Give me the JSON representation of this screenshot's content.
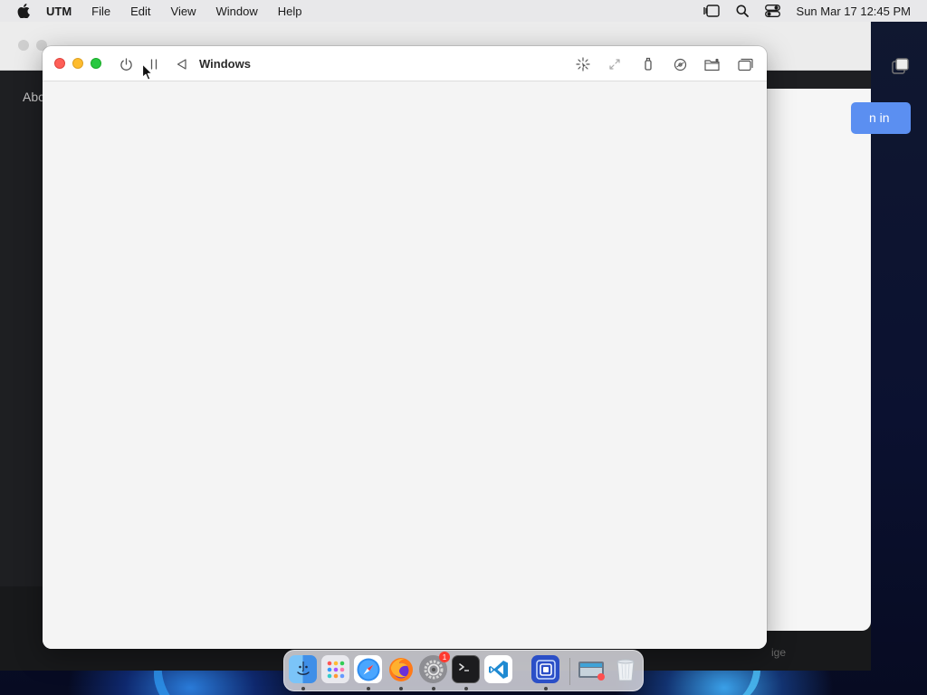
{
  "menubar": {
    "app_name": "UTM",
    "menus": [
      "File",
      "Edit",
      "View",
      "Window",
      "Help"
    ],
    "datetime": "Sun Mar 17  12:45 PM",
    "icons": [
      "apple-icon",
      "stage-manager-icon",
      "spotlight-search-icon",
      "control-center-icon"
    ]
  },
  "background_window": {
    "about_text": "Abc",
    "signin_text": "n in",
    "ghost_text": "ige"
  },
  "utm_window": {
    "title": "Windows",
    "toolbar_icons_left": [
      "power-icon",
      "pause-icon",
      "back-icon"
    ],
    "toolbar_icons_right": [
      "capture-input-icon",
      "resize-icon",
      "usb-icon",
      "drive-icon",
      "shared-folder-icon",
      "windows-icon"
    ]
  },
  "dock": {
    "apps": [
      {
        "name": "Finder",
        "icon": "finder-icon",
        "running": true
      },
      {
        "name": "Launchpad",
        "icon": "launchpad-icon",
        "running": false
      },
      {
        "name": "Safari",
        "icon": "safari-icon",
        "running": true
      },
      {
        "name": "Firefox",
        "icon": "firefox-icon",
        "running": true
      },
      {
        "name": "System Settings",
        "icon": "settings-icon",
        "running": true,
        "badge": "1"
      },
      {
        "name": "Terminal",
        "icon": "terminal-icon",
        "running": true
      },
      {
        "name": "Visual Studio Code",
        "icon": "vscode-icon",
        "running": false
      },
      {
        "name": "UTM",
        "icon": "utm-icon",
        "running": true
      },
      {
        "name": "Preview",
        "icon": "preview-icon",
        "running": false
      },
      {
        "name": "Trash",
        "icon": "trash-icon",
        "running": false
      }
    ]
  },
  "colors": {
    "close": "#fe5f57",
    "minimize": "#febc2e",
    "maximize": "#28c840",
    "accent": "#5b8ff1"
  }
}
